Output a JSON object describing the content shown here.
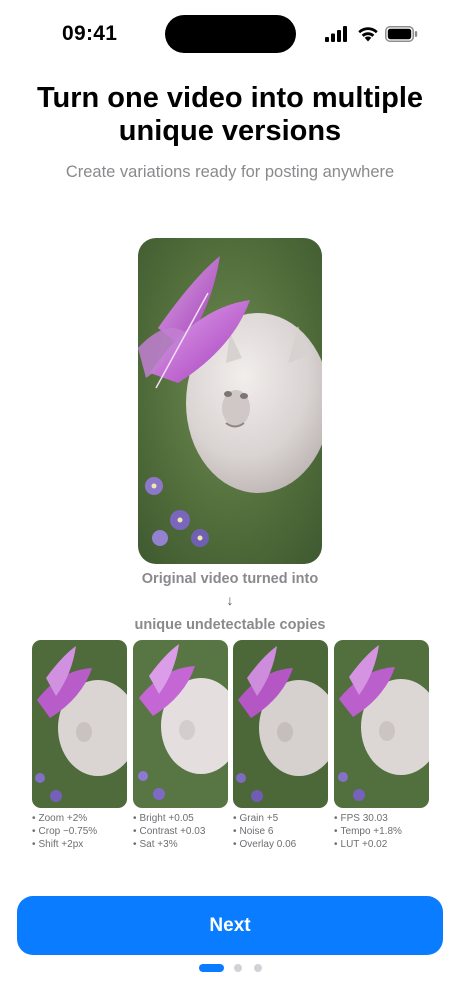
{
  "status_bar": {
    "time": "09:41",
    "icons": [
      "signal-icon",
      "wifi-icon",
      "battery-icon"
    ]
  },
  "onboarding": {
    "title": "Turn one video into multiple unique versions",
    "subtitle": "Create variations ready for posting anywhere",
    "caption_top": "Original video turned into",
    "arrow": "↓",
    "caption_bottom": "unique undetectable copies",
    "variants": [
      {
        "params": [
          "Zoom +2%",
          "Crop −0.75%",
          "Shift +2px"
        ]
      },
      {
        "params": [
          "Bright +0.05",
          "Contrast +0.03",
          "Sat +3%"
        ]
      },
      {
        "params": [
          "Grain +5",
          "Noise 6",
          "Overlay 0.06"
        ]
      },
      {
        "params": [
          "FPS 30.03",
          "Tempo +1.8%",
          "LUT +0.02"
        ]
      }
    ],
    "next_label": "Next",
    "pager": {
      "pages": 3,
      "current": 1
    }
  },
  "colors": {
    "accent": "#0a7cff",
    "secondary_text": "#8a8a8e",
    "inactive_dot": "#d1d1d6"
  }
}
